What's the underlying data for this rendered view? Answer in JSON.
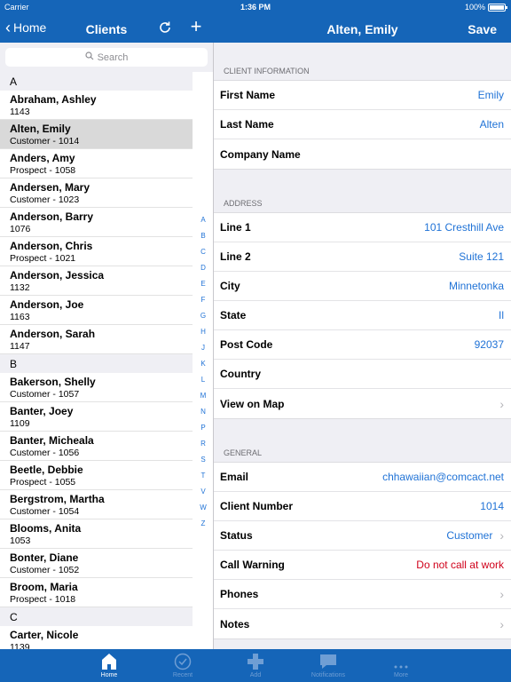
{
  "status": {
    "carrier": "Carrier",
    "time": "1:36 PM",
    "battery": "100%"
  },
  "nav": {
    "back": "Home",
    "left_title": "Clients",
    "right_title": "Alten, Emily",
    "save": "Save"
  },
  "search": {
    "placeholder": "Search"
  },
  "clients": [
    {
      "section": "A"
    },
    {
      "name": "Abraham, Ashley",
      "sub": "1143"
    },
    {
      "name": "Alten, Emily",
      "sub": "Customer - 1014",
      "selected": true
    },
    {
      "name": "Anders, Amy",
      "sub": "Prospect - 1058"
    },
    {
      "name": "Andersen, Mary",
      "sub": "Customer - 1023"
    },
    {
      "name": "Anderson, Barry",
      "sub": "1076"
    },
    {
      "name": "Anderson, Chris",
      "sub": "Prospect - 1021"
    },
    {
      "name": "Anderson, Jessica",
      "sub": "1132"
    },
    {
      "name": "Anderson, Joe",
      "sub": "1163"
    },
    {
      "name": "Anderson, Sarah",
      "sub": "1147"
    },
    {
      "section": "B"
    },
    {
      "name": "Bakerson, Shelly",
      "sub": "Customer - 1057"
    },
    {
      "name": "Banter, Joey",
      "sub": "1109"
    },
    {
      "name": "Banter, Micheala",
      "sub": "Customer - 1056"
    },
    {
      "name": "Beetle, Debbie",
      "sub": "Prospect - 1055"
    },
    {
      "name": "Bergstrom, Martha",
      "sub": "Customer - 1054"
    },
    {
      "name": "Blooms, Anita",
      "sub": "1053"
    },
    {
      "name": "Bonter, Diane",
      "sub": "Customer - 1052"
    },
    {
      "name": "Broom, Maria",
      "sub": "Prospect - 1018"
    },
    {
      "section": "C"
    },
    {
      "name": "Carter, Nicole",
      "sub": "1139"
    }
  ],
  "index_letters": [
    "A",
    "B",
    "C",
    "D",
    "E",
    "F",
    "G",
    "H",
    "J",
    "K",
    "L",
    "M",
    "N",
    "P",
    "R",
    "S",
    "T",
    "V",
    "W",
    "Z"
  ],
  "detail": {
    "client_info": {
      "header": "CLIENT INFORMATION",
      "rows": [
        {
          "label": "First Name",
          "value": "Emily"
        },
        {
          "label": "Last Name",
          "value": "Alten"
        },
        {
          "label": "Company Name",
          "value": ""
        }
      ]
    },
    "address": {
      "header": "ADDRESS",
      "rows": [
        {
          "label": "Line 1",
          "value": "101 Cresthill Ave"
        },
        {
          "label": "Line 2",
          "value": "Suite 121"
        },
        {
          "label": "City",
          "value": "Minnetonka"
        },
        {
          "label": "State",
          "value": "Il"
        },
        {
          "label": "Post Code",
          "value": "92037"
        },
        {
          "label": "Country",
          "value": ""
        },
        {
          "label": "View on Map",
          "value": "",
          "chevron": true
        }
      ]
    },
    "general": {
      "header": "GENERAL",
      "rows": [
        {
          "label": "Email",
          "value": "chhawaiian@comcact.net"
        },
        {
          "label": "Client Number",
          "value": "1014"
        },
        {
          "label": "Status",
          "value": "Customer",
          "chevron": true
        },
        {
          "label": "Call Warning",
          "value": "Do not call at work",
          "warn": true
        },
        {
          "label": "Phones",
          "value": "",
          "chevron": true
        },
        {
          "label": "Notes",
          "value": "",
          "chevron": true
        }
      ]
    }
  },
  "tabs": [
    {
      "label": "Home",
      "icon": "home-icon",
      "active": true
    },
    {
      "label": "Recent",
      "icon": "clock-icon",
      "active": false
    },
    {
      "label": "Add",
      "icon": "plus-icon",
      "active": false
    },
    {
      "label": "Notifications",
      "icon": "speech-bubble-icon",
      "active": false
    },
    {
      "label": "More",
      "icon": "ellipsis-icon",
      "active": false
    }
  ],
  "colors": {
    "bar": "#1565b8",
    "link": "#1f72d6",
    "warning": "#d0021b"
  }
}
